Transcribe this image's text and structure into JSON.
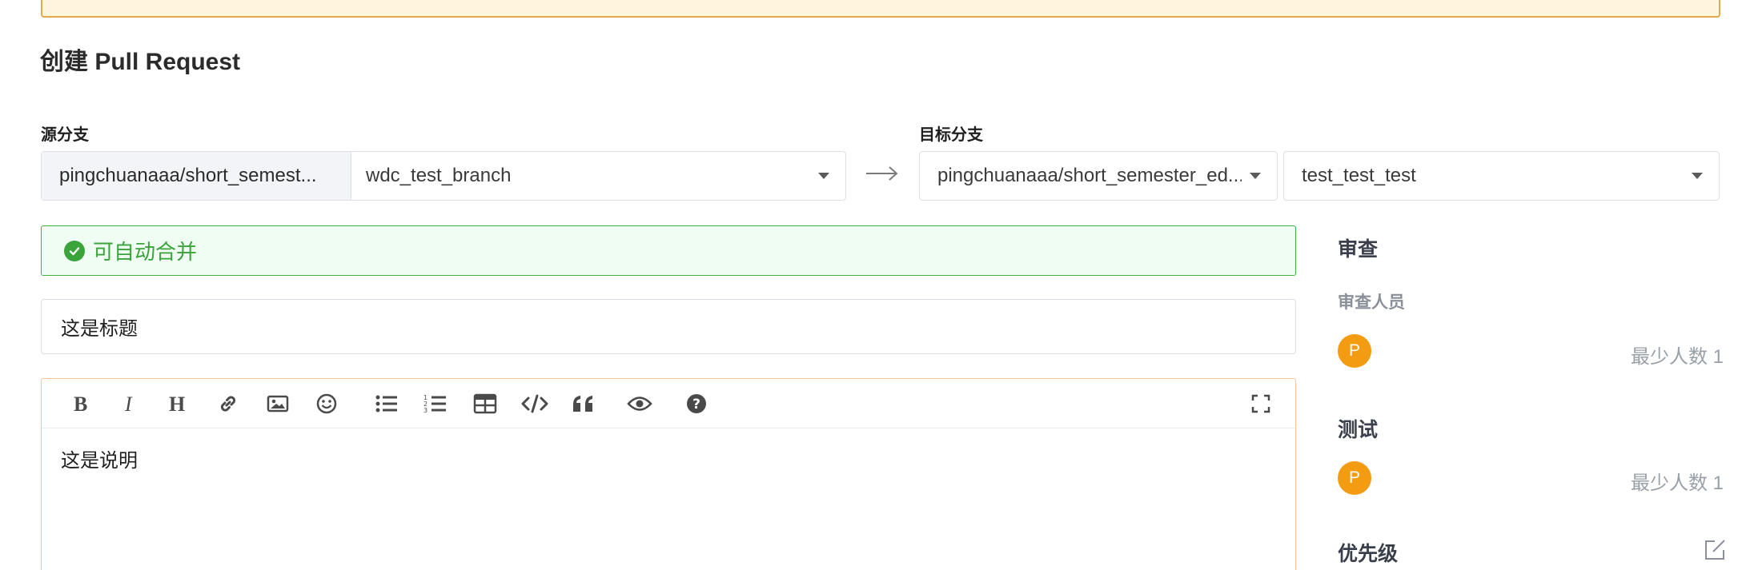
{
  "page": {
    "title": "创建 Pull Request"
  },
  "source_branch": {
    "label": "源分支",
    "repo": "pingchuanaaa/short_semest...",
    "branch": "wdc_test_branch"
  },
  "target_branch": {
    "label": "目标分支",
    "repo": "pingchuanaaa/short_semester_ed...",
    "branch": "test_test_test"
  },
  "merge_status": {
    "text": "可自动合并",
    "color": "#3aa33a"
  },
  "form": {
    "title_value": "这是标题",
    "description_value": "这是说明"
  },
  "toolbar": {
    "items": [
      "bold-icon",
      "italic-icon",
      "heading-icon",
      "link-icon",
      "image-icon",
      "emoji-icon",
      "unordered-list-icon",
      "ordered-list-icon",
      "table-icon",
      "code-icon",
      "quote-icon",
      "preview-icon",
      "help-icon",
      "fullscreen-icon"
    ]
  },
  "sidebar": {
    "review": {
      "heading": "审查",
      "reviewers_label": "审查人员",
      "reviewer_avatar": "P",
      "min_count": "最少人数 1"
    },
    "test": {
      "heading": "测试",
      "tester_avatar": "P",
      "min_count": "最少人数 1"
    },
    "priority": {
      "heading": "优先级"
    }
  },
  "colors": {
    "accent_orange": "#f39c12",
    "success_green": "#3aa33a",
    "warning_border": "#e2a94b"
  }
}
